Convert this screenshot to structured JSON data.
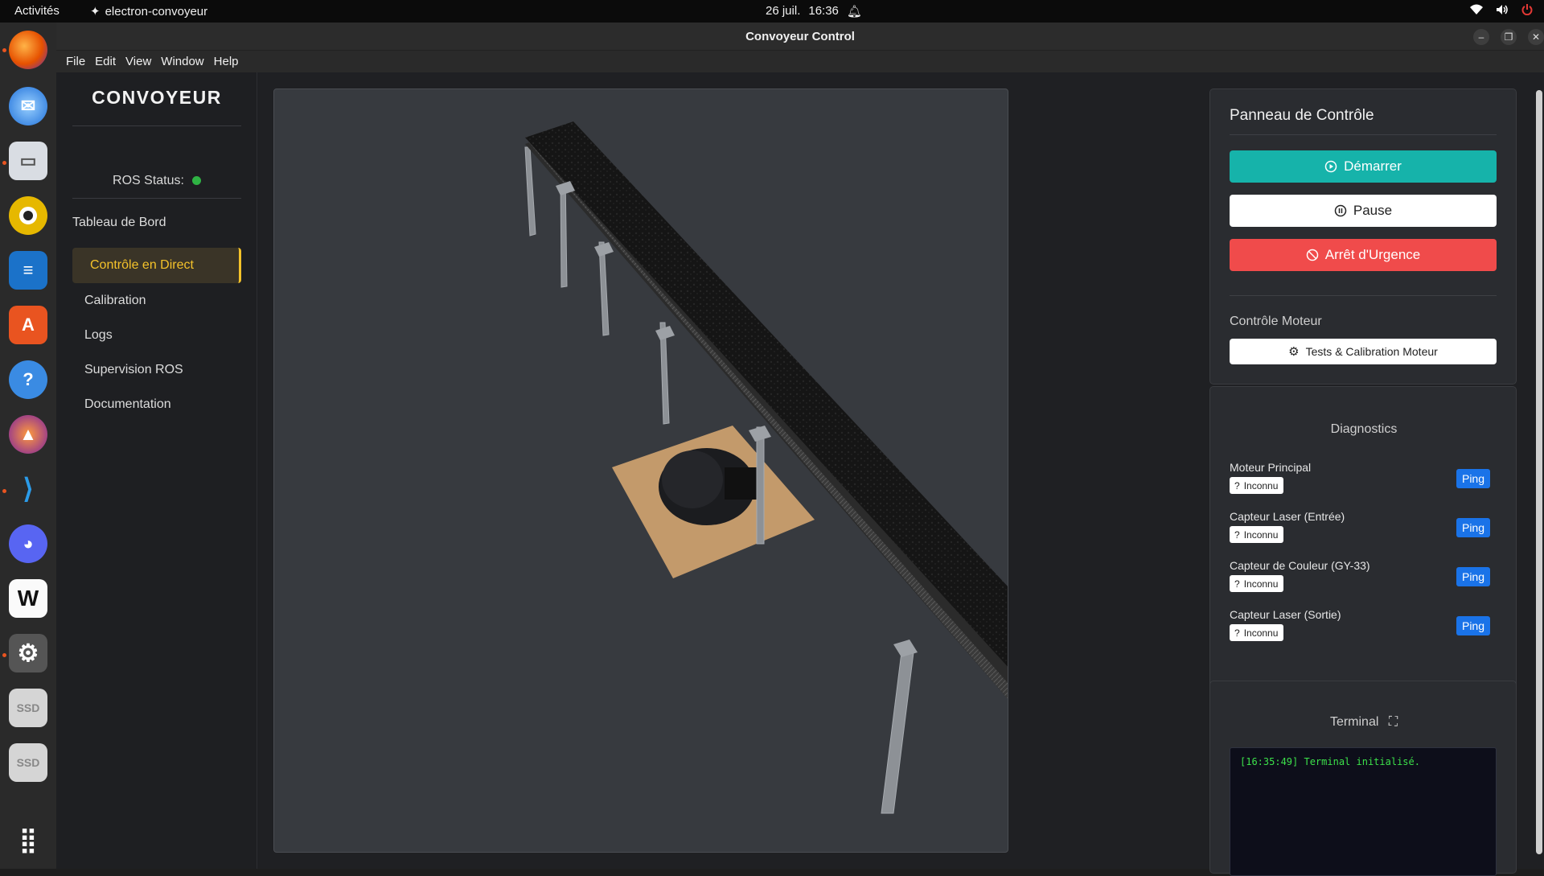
{
  "topbar": {
    "activities": "Activités",
    "app_name": "electron-convoyeur",
    "date": "26 juil.",
    "time": "16:36"
  },
  "dock": {
    "items": [
      "firefox-icon",
      "thunderbird-icon",
      "files-icon",
      "rhythmbox-icon",
      "writer-icon",
      "software-icon",
      "help-icon",
      "pixel-icon",
      "vscode-icon",
      "discord-icon",
      "wps-icon",
      "settings-icon",
      "ssd-icon",
      "ssd-icon",
      "apps-grid-icon"
    ],
    "ssd_label": "SSD"
  },
  "window": {
    "title": "Convoyeur Control"
  },
  "menu": [
    "File",
    "Edit",
    "View",
    "Window",
    "Help"
  ],
  "sidebar": {
    "brand": "CONVOYEUR",
    "ros_status_label": "ROS Status:",
    "ros_status_color": "#2fb344",
    "section_title": "Tableau de Bord",
    "items": [
      {
        "label": "Contrôle en Direct",
        "active": true
      },
      {
        "label": "Calibration"
      },
      {
        "label": "Logs"
      },
      {
        "label": "Supervision ROS"
      },
      {
        "label": "Documentation"
      }
    ]
  },
  "control_panel": {
    "title": "Panneau de Contrôle",
    "start": "Démarrer",
    "pause": "Pause",
    "emergency": "Arrêt d'Urgence",
    "motor_section": "Contrôle Moteur",
    "motor_button": "Tests & Calibration Moteur"
  },
  "diagnostics": {
    "title": "Diagnostics",
    "ping_label": "Ping",
    "rows": [
      {
        "label": "Moteur Principal",
        "status": "Inconnu"
      },
      {
        "label": "Capteur Laser (Entrée)",
        "status": "Inconnu"
      },
      {
        "label": "Capteur de Couleur (GY-33)",
        "status": "Inconnu"
      },
      {
        "label": "Capteur Laser (Sortie)",
        "status": "Inconnu"
      }
    ]
  },
  "terminal": {
    "title": "Terminal",
    "lines": [
      "[16:35:49] Terminal initialisé."
    ]
  },
  "colors": {
    "accent": "#f4c22a",
    "teal": "#16b3aa",
    "danger": "#f04b4b",
    "ping": "#1a73e8"
  }
}
